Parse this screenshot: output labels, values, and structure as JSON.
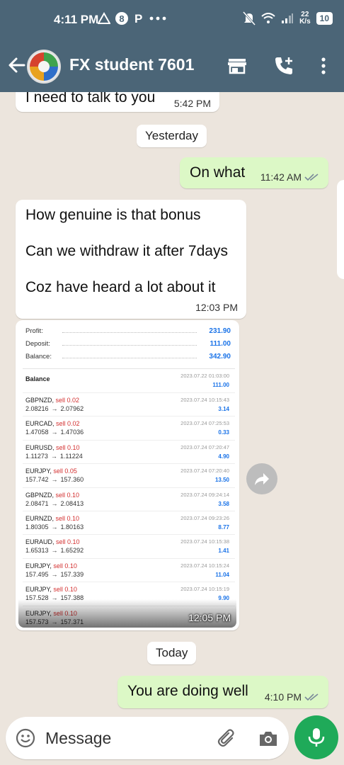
{
  "status_bar": {
    "time": "4:11 PM",
    "left_icons": [
      "alert-triangle-icon",
      "b-circle-icon",
      "p-letter-icon",
      "more-dots-icon"
    ],
    "net_speed_value": "22",
    "net_speed_unit": "K/s",
    "battery": "10",
    "right_icons": [
      "bell-off-icon",
      "wifi-icon",
      "signal-icon",
      "battery-icon"
    ]
  },
  "header": {
    "contact_name": "FX student 7601",
    "icons": [
      "back-arrow-icon",
      "avatar",
      "shop-icon",
      "add-call-icon",
      "more-vert-icon"
    ]
  },
  "colors": {
    "header_bg": "#4b6577",
    "chat_bg": "#ece5dd",
    "incoming_bubble": "#ffffff",
    "outgoing_bubble": "#dcf8c6",
    "mic_button": "#1faa59",
    "read_ticks": "#7a8a99",
    "sell_red": "#d32f2f",
    "value_blue": "#1a73e8"
  },
  "messages": [
    {
      "type": "incoming",
      "text": "I need to talk to you",
      "time": "5:42 PM"
    },
    {
      "type": "date",
      "text": "Yesterday"
    },
    {
      "type": "outgoing",
      "text": "On what",
      "time": "11:42 AM",
      "status": "read"
    },
    {
      "type": "incoming",
      "lines": [
        "How genuine is that bonus",
        "Can we withdraw it after 7days",
        "Coz have heard a lot about it"
      ],
      "time": "12:03 PM"
    },
    {
      "type": "incoming-image",
      "time": "12:05 PM"
    },
    {
      "type": "date",
      "text": "Today"
    },
    {
      "type": "outgoing",
      "text": "You are doing well",
      "time": "4:10 PM",
      "status": "read"
    }
  ],
  "report": {
    "summary": [
      {
        "label": "Profit:",
        "value": "231.90"
      },
      {
        "label": "Deposit:",
        "value": "111.00"
      },
      {
        "label": "Balance:",
        "value": "342.90"
      }
    ],
    "balance_entry": {
      "label": "Balance",
      "datetime": "2023.07.22 01:03:00",
      "amount": "111.00"
    },
    "trades": [
      {
        "symbol": "GBPNZD,",
        "side": "sell 0.02",
        "open": "2.08216",
        "close": "2.07962",
        "datetime": "2023.07.24 10:15:43",
        "profit": "3.14"
      },
      {
        "symbol": "EURCAD,",
        "side": "sell 0.02",
        "open": "1.47058",
        "close": "1.47036",
        "datetime": "2023.07.24 07:25:53",
        "profit": "0.33"
      },
      {
        "symbol": "EURUSD,",
        "side": "sell 0.10",
        "open": "1.11273",
        "close": "1.11224",
        "datetime": "2023.07.24 07:20:47",
        "profit": "4.90"
      },
      {
        "symbol": "EURJPY,",
        "side": "sell 0.05",
        "open": "157.742",
        "close": "157.360",
        "datetime": "2023.07.24 07:20:40",
        "profit": "13.50"
      },
      {
        "symbol": "GBPNZD,",
        "side": "sell 0.10",
        "open": "2.08471",
        "close": "2.08413",
        "datetime": "2023.07.24 09:24:14",
        "profit": "3.58"
      },
      {
        "symbol": "EURNZD,",
        "side": "sell 0.10",
        "open": "1.80305",
        "close": "1.80163",
        "datetime": "2023.07.24 09:23:26",
        "profit": "8.77"
      },
      {
        "symbol": "EURAUD,",
        "side": "sell 0.10",
        "open": "1.65313",
        "close": "1.65292",
        "datetime": "2023.07.24 10:15:38",
        "profit": "1.41"
      },
      {
        "symbol": "EURJPY,",
        "side": "sell 0.10",
        "open": "157.495",
        "close": "157.339",
        "datetime": "2023.07.24 10:15:24",
        "profit": "11.04"
      },
      {
        "symbol": "EURJPY,",
        "side": "sell 0.10",
        "open": "157.528",
        "close": "157.388",
        "datetime": "2023.07.24 10:15:19",
        "profit": "9.90"
      },
      {
        "symbol": "EURJPY,",
        "side": "sell 0.10",
        "open": "157.573",
        "close": "157.371",
        "datetime": "",
        "profit": ""
      }
    ],
    "price_separator": "→"
  },
  "composer": {
    "placeholder": "Message",
    "icons": [
      "emoji-icon",
      "attach-icon",
      "camera-icon",
      "mic-icon"
    ]
  },
  "side_actions": {
    "forward_icon": "forward-icon"
  }
}
